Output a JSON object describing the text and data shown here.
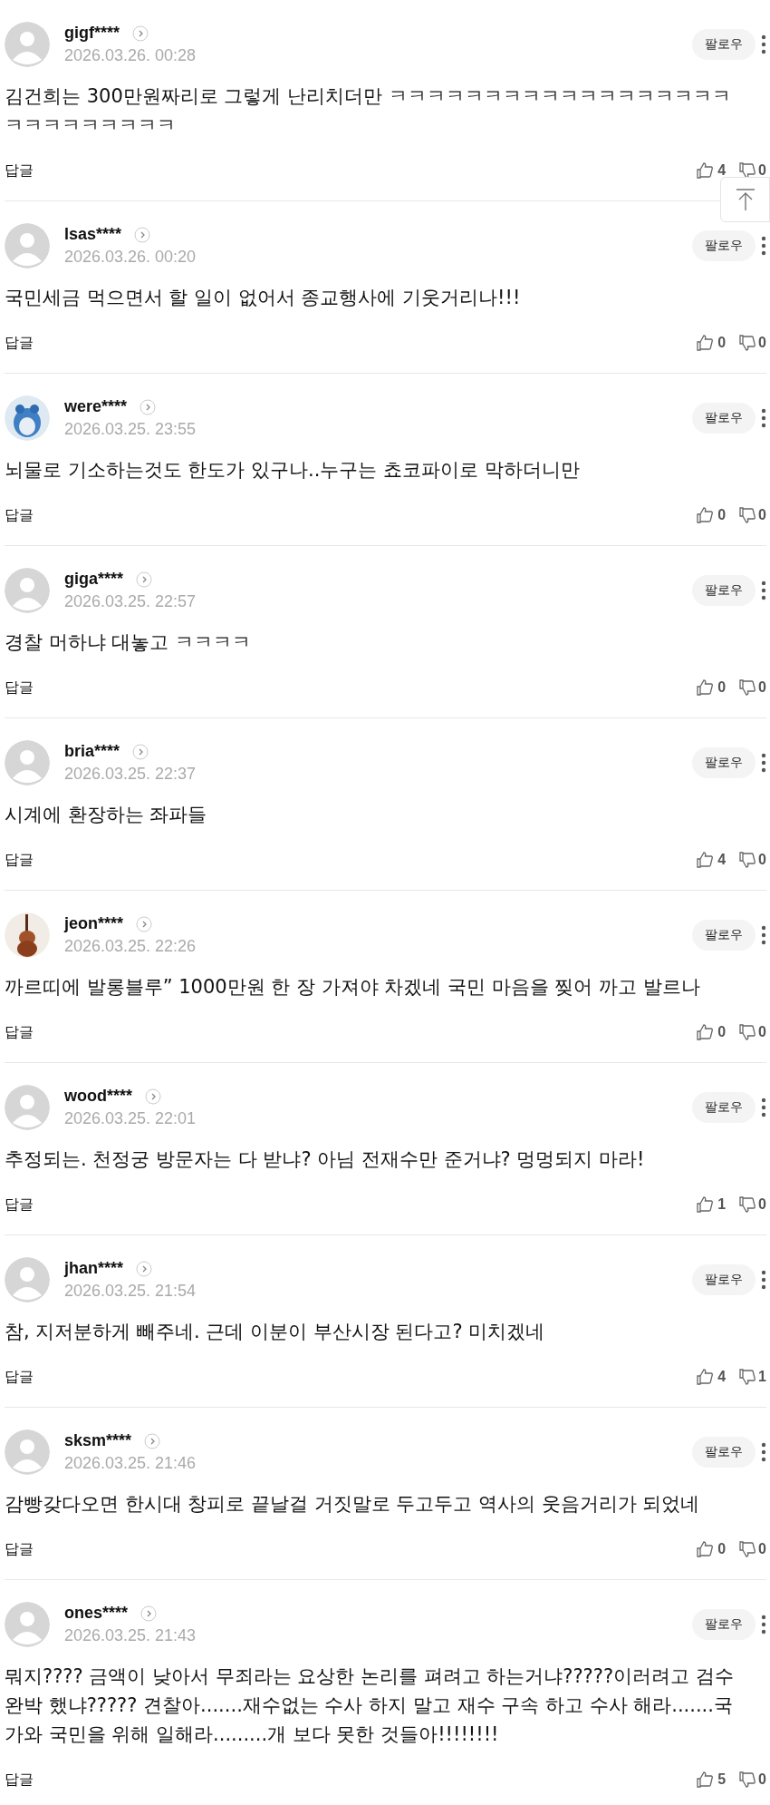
{
  "comments": [
    {
      "user": "gigf****",
      "avatar": {
        "kind": "default"
      },
      "date": "2026.03.26. 00:28",
      "follow": "팔로우",
      "text": "김건희는 300만원짜리로 그렇게 난리치더만 ㅋㅋㅋㅋㅋㅋㅋㅋㅋㅋㅋㅋㅋㅋㅋㅋㅋㅋㅋㅋㅋㅋㅋㅋㅋㅋㅋ",
      "reply": "답글",
      "likes": "4",
      "dislikes": "0"
    },
    {
      "user": "lsas****",
      "avatar": {
        "kind": "default"
      },
      "date": "2026.03.26. 00:20",
      "follow": "팔로우",
      "text": "국민세금 먹으면서 할 일이 없어서 종교행사에 기웃거리나!!!",
      "reply": "답글",
      "likes": "0",
      "dislikes": "0"
    },
    {
      "user": "were****",
      "date": "2026.03.25. 23:55",
      "follow": "팔로우",
      "text": "뇌물로 기소하는것도 한도가 있구나..누구는 쵸코파이로 막하더니만",
      "reply": "답글",
      "likes": "0",
      "dislikes": "0"
    },
    {
      "user": "giga****",
      "avatar": {
        "kind": "default"
      },
      "date": "2026.03.25. 22:57",
      "follow": "팔로우",
      "text": "경찰 머하냐 대놓고 ㅋㅋㅋㅋ",
      "reply": "답글",
      "likes": "0",
      "dislikes": "0"
    },
    {
      "user": "bria****",
      "avatar": {
        "kind": "default"
      },
      "date": "2026.03.25. 22:37",
      "follow": "팔로우",
      "text": "시계에 환장하는 좌파들",
      "reply": "답글",
      "likes": "4",
      "dislikes": "0"
    },
    {
      "user": "jeon****",
      "date": "2026.03.25. 22:26",
      "follow": "팔로우",
      "text": "까르띠에 발롱블루” 1000만원 한 장 가져야 차겠네 국민 마음을 찢어 까고 발르나",
      "reply": "답글",
      "likes": "0",
      "dislikes": "0"
    },
    {
      "user": "wood****",
      "avatar": {
        "kind": "default"
      },
      "date": "2026.03.25. 22:01",
      "follow": "팔로우",
      "text": "추정되는. 천정궁 방문자는 다 받냐? 아님 전재수만 준거냐? 멍멍되지 마라!",
      "reply": "답글",
      "likes": "1",
      "dislikes": "0"
    },
    {
      "user": "jhan****",
      "avatar": {
        "kind": "default"
      },
      "date": "2026.03.25. 21:54",
      "follow": "팔로우",
      "text": "참, 지저분하게 빼주네. 근데 이분이 부산시장 된다고? 미치겠네",
      "reply": "답글",
      "likes": "4",
      "dislikes": "1"
    },
    {
      "user": "sksm****",
      "avatar": {
        "kind": "default"
      },
      "date": "2026.03.25. 21:46",
      "follow": "팔로우",
      "text": "감빵갖다오면 한시대 창피로 끝날걸 거짓말로 두고두고 역사의 웃음거리가 되었네",
      "reply": "답글",
      "likes": "0",
      "dislikes": "0"
    },
    {
      "user": "ones****",
      "avatar": {
        "kind": "default"
      },
      "date": "2026.03.25. 21:43",
      "follow": "팔로우",
      "text": "뭐지???? 금액이 낮아서 무죄라는 요상한 논리를 펴려고 하는거냐?????이러려고 검수완박 했냐????? 견찰아.......재수없는 수사 하지 말고 재수 구속 하고 수사 해라.......국가와 국민을 위해 일해라.........개 보다 못한 것들아!!!!!!!!",
      "reply": "답글",
      "likes": "5",
      "dislikes": "0"
    }
  ]
}
